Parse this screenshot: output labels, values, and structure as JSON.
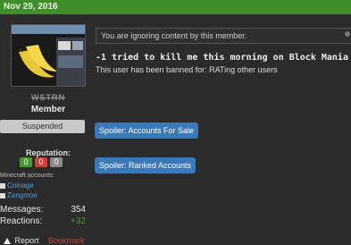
{
  "post": {
    "date": "Nov 29, 2016",
    "ignore_notice": "You are ignoring content by this member.",
    "title_line": "-1 tried to kill me this morning on Block Mania",
    "ban_notice": "This user has been banned for: RATing other users",
    "spoilers": [
      "Spoiler: Accounts For Sale",
      "Spoiler: Ranked Accounts"
    ]
  },
  "user": {
    "name": "WSTRN",
    "title": "Member",
    "banner": "Suspended",
    "reputation_label": "Reputation:",
    "reputation": {
      "positive": "0",
      "negative": "0",
      "neutral": "0"
    },
    "minecraft_label": "Minecraft accounts:",
    "minecraft_accounts": [
      "Coinage",
      "Zangmoo"
    ],
    "stats": [
      {
        "label": "Messages:",
        "value": "354"
      },
      {
        "label": "Reactions:",
        "value": "+32"
      }
    ]
  },
  "actions": {
    "report": "Report",
    "bookmark": "Bookmark"
  },
  "colors": {
    "topbar": "#3e8e2a",
    "spoiler": "#3a78b8",
    "positive": "#4a9a33",
    "negative": "#c9413a",
    "link": "#5b9bd5"
  }
}
